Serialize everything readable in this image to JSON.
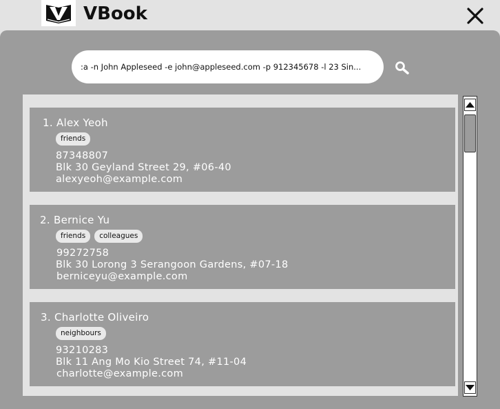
{
  "app": {
    "title": "VBook"
  },
  "search": {
    "command": ":a -n John Appleseed -e john@appleseed.com -p 912345678 -l 23 Sin..."
  },
  "contacts": [
    {
      "name": "1. Alex Yeoh",
      "tags": [
        "friends"
      ],
      "phone": "87348807",
      "address": "Blk 30 Geyland Street 29, #06-40",
      "email": "alexyeoh@example.com"
    },
    {
      "name": "2. Bernice Yu",
      "tags": [
        "friends",
        "colleagues"
      ],
      "phone": "99272758",
      "address": "Blk 30 Lorong 3 Serangoon Gardens, #07-18",
      "email": "berniceyu@example.com"
    },
    {
      "name": "3. Charlotte Oliveiro",
      "tags": [
        "neighbours"
      ],
      "phone": "93210283",
      "address": "Blk 11 Ang Mo Kio Street 74, #11-04",
      "email": "charlotte@example.com"
    }
  ],
  "colors": {
    "background": "#e3e3e3",
    "panel": "#9c9c9c",
    "card": "#9c9c9c",
    "tag": "#e9e9e9",
    "text_on_card": "#ffffff"
  },
  "icons": {
    "logo": "vbook-logo-icon",
    "close": "close-icon",
    "search": "search-icon",
    "scroll_up": "triangle-up-icon",
    "scroll_down": "triangle-down-icon"
  }
}
